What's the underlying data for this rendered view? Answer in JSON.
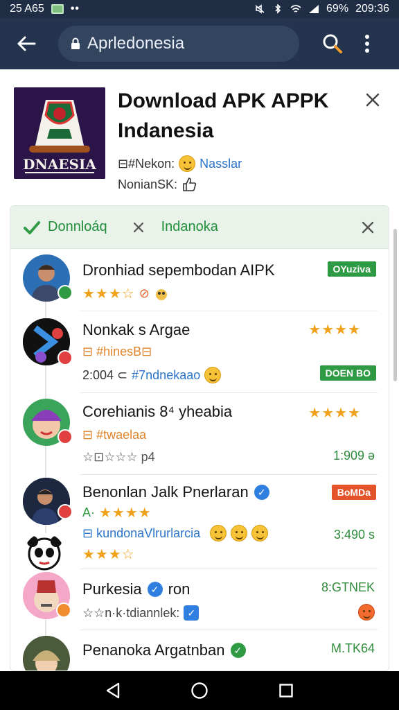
{
  "status_bar": {
    "time_left": "25 A65",
    "battery": "69%",
    "time_right": "209:36",
    "icons": [
      "image-icon",
      "dots-icon",
      "mute-icon",
      "bluetooth-icon",
      "wifi-icon",
      "signal-icon"
    ]
  },
  "toolbar": {
    "url": "Aprledonesia",
    "icons": [
      "back-arrow-icon",
      "lock-icon",
      "search-icon",
      "more-vert-icon"
    ]
  },
  "header": {
    "title": "Download APK APPK Indanesia",
    "logo_text": "DNAESIA",
    "meta1_prefix": "⊟#Nekon:",
    "meta1_link": "Nasslar",
    "meta2": "NonianSK:"
  },
  "panel": {
    "tab1": "Donnloáq",
    "tab2": "Indanoka"
  },
  "rows": [
    {
      "title": "Dronhiad sepembodan AIPK",
      "stars": "★★★☆",
      "extra": "⊘",
      "tag": "OYuziva",
      "tag_color": "#2e9b44"
    },
    {
      "title": "Nonkak s Argae",
      "line1": "⊟ #hinesB⊟",
      "line2_prefix": "2:004 ⊂",
      "line2_link": "#7ndnekaao",
      "right_stars": "★★★★",
      "tag": "DOEN BO",
      "tag_color": "#2e9b44"
    },
    {
      "title": "Corehianis 8⁴ yheabia",
      "line1": "⊟ #twaelaa",
      "line2": "☆⊡☆☆☆ p4",
      "right_stars": "★★★★",
      "right_val": "1:909 ə"
    },
    {
      "title": "Benonlan Jalk Pnerlaran",
      "line1_prefix": "A·",
      "line1_stars": "★★★★",
      "line2": "⊟ kundonaVlrurlarcia",
      "line3_stars": "★★★☆",
      "right_val": "3:490 s",
      "tag": "BoMDa",
      "tag_color": "#e5532b"
    },
    {
      "title": "Purkesia",
      "title_suffix": "ron",
      "line1": "☆☆n·k·tdiannlek:",
      "right_val": "8:GTNEK"
    },
    {
      "title": "Penanoka Argatnban",
      "right_val": "M.TK64"
    }
  ],
  "colors": {
    "toolbar": "#24344f",
    "status_bar": "#1f2d45",
    "accent_green": "#2e9b44",
    "star": "#f0a21a",
    "link_blue": "#2a73c9",
    "tag_red": "#e5532b"
  }
}
